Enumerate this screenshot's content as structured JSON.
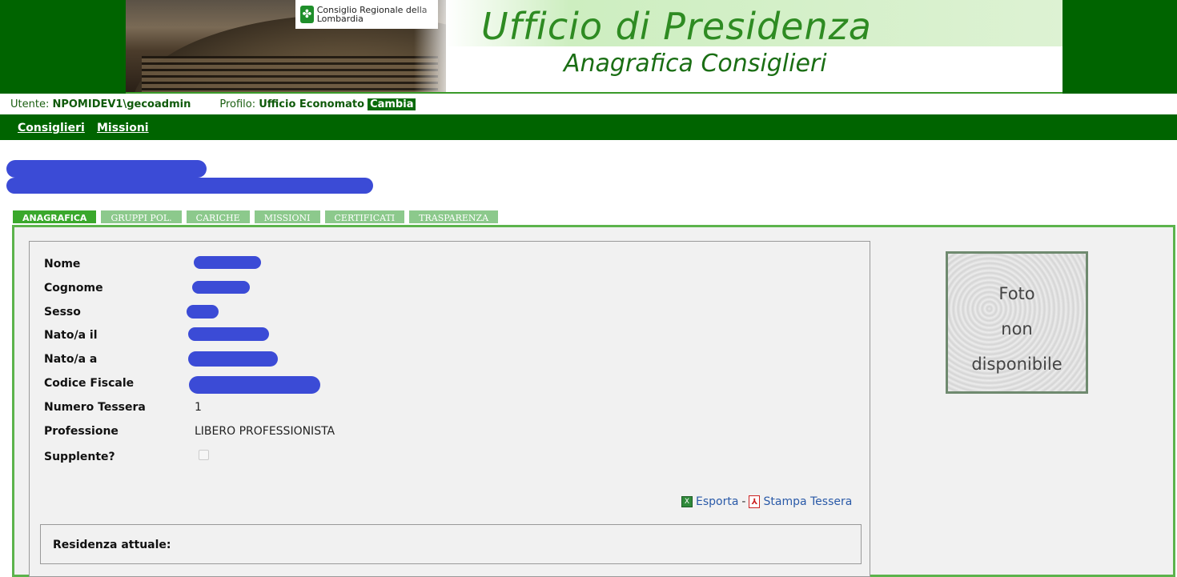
{
  "header": {
    "logo_text": "Consiglio Regionale della Lombardia",
    "title": "Ufficio di Presidenza",
    "subtitle": "Anagrafica Consiglieri"
  },
  "userbar": {
    "user_label": "Utente:",
    "user_value": "NPOMIDEV1\\gecoadmin",
    "profile_label": "Profilo:",
    "profile_value": "Ufficio Economato",
    "change_label": "Cambia"
  },
  "nav": {
    "items": [
      {
        "label": "Consiglieri"
      },
      {
        "label": "Missioni"
      }
    ]
  },
  "tabs": [
    {
      "label": "ANAGRAFICA",
      "active": true
    },
    {
      "label": "GRUPPI POL.",
      "active": false
    },
    {
      "label": "CARICHE",
      "active": false
    },
    {
      "label": "MISSIONI",
      "active": false
    },
    {
      "label": "CERTIFICATI",
      "active": false
    },
    {
      "label": "TRASPARENZA",
      "active": false
    }
  ],
  "fields": {
    "nome_label": "Nome",
    "cognome_label": "Cognome",
    "sesso_label": "Sesso",
    "nato_il_label": "Nato/a il",
    "nato_a_label": "Nato/a a",
    "codice_fiscale_label": "Codice Fiscale",
    "numero_tessera_label": "Numero Tessera",
    "numero_tessera_value": "1",
    "professione_label": "Professione",
    "professione_value": "LIBERO PROFESSIONISTA",
    "supplente_label": "Supplente?"
  },
  "actions": {
    "export_label": "Esporta",
    "separator": "-",
    "print_label": "Stampa Tessera"
  },
  "residenza": {
    "title": "Residenza attuale:"
  },
  "photo": {
    "placeholder": "Foto\nnon\ndisponibile"
  },
  "colors": {
    "header_green": "#006400",
    "tab_active": "#3aa82c",
    "tab_inactive": "#8cc98c",
    "redaction": "#3b4bd6"
  }
}
